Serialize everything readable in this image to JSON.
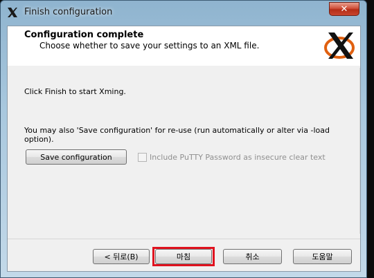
{
  "window": {
    "title": "Finish configuration",
    "close_label": "✕"
  },
  "header": {
    "title": "Configuration complete",
    "subtitle": "Choose whether to save your settings to an XML file."
  },
  "body": {
    "text1": "Click Finish to start Xming.",
    "text2": "You may also 'Save configuration' for re-use (run automatically or alter via -load option).",
    "save_button": "Save configuration",
    "checkbox_label": "Include PuTTY Password as insecure clear text",
    "checkbox_checked": false,
    "checkbox_enabled": false
  },
  "footer": {
    "back_label": "< 뒤로(B)",
    "finish_label": "마침",
    "cancel_label": "취소",
    "help_label": "도움말"
  },
  "icons": {
    "app": "xming-x-icon",
    "logo": "xming-logo-icon",
    "close": "close-icon"
  },
  "colors": {
    "highlight": "#e0121f",
    "logo_orange": "#e06010"
  }
}
